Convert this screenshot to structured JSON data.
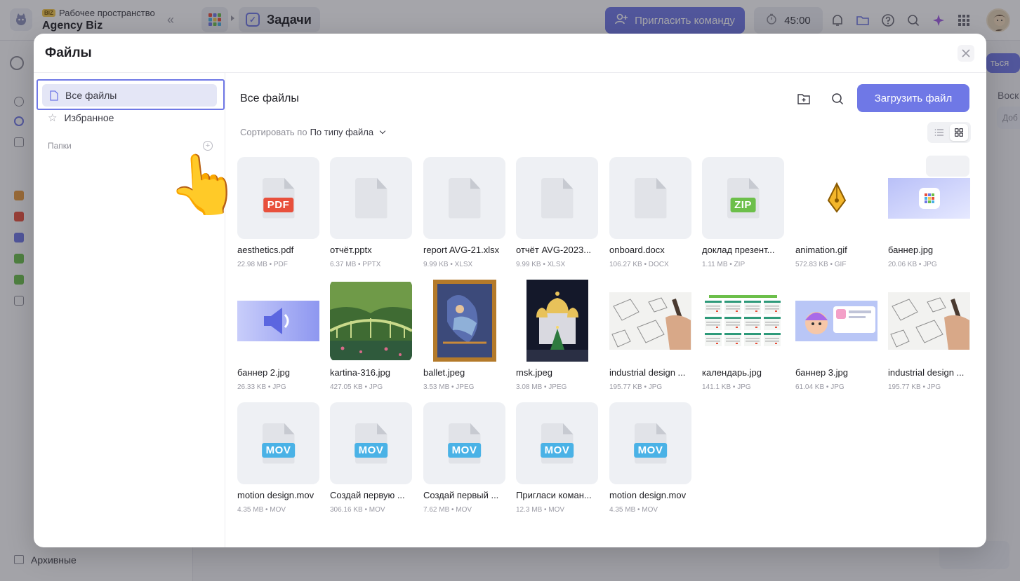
{
  "app": {
    "workspace_badge": "BIZ",
    "workspace_label": "Рабочее пространство",
    "workspace_name": "Agency Biz",
    "current_page": "Задачи",
    "invite_label": "Пригласить команду",
    "timer": "45:00",
    "archive_label": "Архивные",
    "peek_button": "ться",
    "peek_text": "Воск",
    "peek_add": "Доб"
  },
  "modal": {
    "title": "Файлы",
    "sidebar": {
      "all_files": "Все файлы",
      "favorites": "Избранное",
      "folders": "Папки"
    },
    "main": {
      "title": "Все файлы",
      "upload_label": "Загрузить файл",
      "sort_prefix": "Сортировать по",
      "sort_value": "По типу файла"
    },
    "files": [
      {
        "name": "aesthetics.pdf",
        "meta": "22.98 MB • PDF",
        "kind": "doc",
        "badge": "PDF",
        "badge_color": "#e8503c"
      },
      {
        "name": "отчёт.pptx",
        "meta": "6.37 MB • PPTX",
        "kind": "doc",
        "badge": "",
        "badge_color": ""
      },
      {
        "name": "report AVG-21.xlsx",
        "meta": "9.99 KB • XLSX",
        "kind": "doc",
        "badge": "",
        "badge_color": ""
      },
      {
        "name": "отчёт AVG-2023...",
        "meta": "9.99 KB • XLSX",
        "kind": "doc",
        "badge": "",
        "badge_color": ""
      },
      {
        "name": "onboard.docx",
        "meta": "106.27 KB • DOCX",
        "kind": "doc",
        "badge": "",
        "badge_color": ""
      },
      {
        "name": "доклад презент...",
        "meta": "1.11 MB • ZIP",
        "kind": "doc",
        "badge": "ZIP",
        "badge_color": "#6cbf4a"
      },
      {
        "name": "animation.gif",
        "meta": "572.83 KB • GIF",
        "kind": "gif",
        "badge": "",
        "badge_color": ""
      },
      {
        "name": "баннер.jpg",
        "meta": "20.06 KB • JPG",
        "kind": "banner1",
        "badge": "",
        "badge_color": ""
      },
      {
        "name": "баннер 2.jpg",
        "meta": "26.33 KB • JPG",
        "kind": "banner2",
        "badge": "",
        "badge_color": ""
      },
      {
        "name": "kartina-316.jpg",
        "meta": "427.05 KB • JPG",
        "kind": "bridge",
        "badge": "",
        "badge_color": ""
      },
      {
        "name": "ballet.jpeg",
        "meta": "3.53 MB • JPEG",
        "kind": "ballet",
        "badge": "",
        "badge_color": ""
      },
      {
        "name": "msk.jpeg",
        "meta": "3.08 MB • JPEG",
        "kind": "msk",
        "badge": "",
        "badge_color": ""
      },
      {
        "name": "industrial design ...",
        "meta": "195.77 KB • JPG",
        "kind": "sketch",
        "badge": "",
        "badge_color": ""
      },
      {
        "name": "календарь.jpg",
        "meta": "141.1 KB • JPG",
        "kind": "calendar",
        "badge": "",
        "badge_color": ""
      },
      {
        "name": "баннер 3.jpg",
        "meta": "61.04 KB • JPG",
        "kind": "banner3",
        "badge": "",
        "badge_color": ""
      },
      {
        "name": "industrial design ...",
        "meta": "195.77 KB • JPG",
        "kind": "sketch",
        "badge": "",
        "badge_color": ""
      },
      {
        "name": "motion design.mov",
        "meta": "4.35 MB • MOV",
        "kind": "doc",
        "badge": "MOV",
        "badge_color": "#4ab2e6"
      },
      {
        "name": "Создай первую ...",
        "meta": "306.16 KB • MOV",
        "kind": "doc",
        "badge": "MOV",
        "badge_color": "#4ab2e6"
      },
      {
        "name": "Создай первый ...",
        "meta": "7.62 MB • MOV",
        "kind": "doc",
        "badge": "MOV",
        "badge_color": "#4ab2e6"
      },
      {
        "name": "Пригласи коман...",
        "meta": "12.3 MB • MOV",
        "kind": "doc",
        "badge": "MOV",
        "badge_color": "#4ab2e6"
      },
      {
        "name": "motion design.mov",
        "meta": "4.35 MB • MOV",
        "kind": "doc",
        "badge": "MOV",
        "badge_color": "#4ab2e6"
      }
    ]
  },
  "colors": {
    "accent": "#6f78e6",
    "pdf": "#e8503c",
    "zip": "#6cbf4a",
    "mov": "#4ab2e6"
  }
}
